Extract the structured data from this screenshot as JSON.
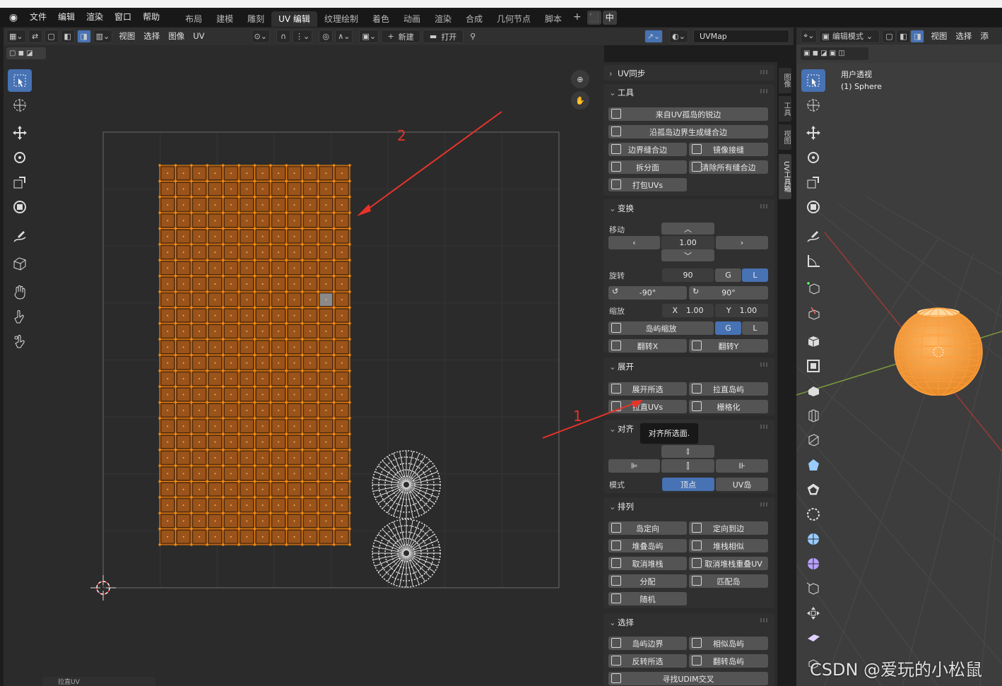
{
  "menubar": {
    "items": [
      "文件",
      "编辑",
      "渲染",
      "窗口",
      "帮助"
    ],
    "workspace_tabs": [
      "布局",
      "建模",
      "雕刻",
      "UV 编辑",
      "纹理绘制",
      "着色",
      "动画",
      "渲染",
      "合成",
      "几何节点",
      "脚本"
    ],
    "active_tab": "UV 编辑",
    "plus": "+",
    "lang_label": "中"
  },
  "uv_header": {
    "menus": [
      "视图",
      "选择",
      "图像",
      "UV"
    ],
    "new_label": "新建",
    "open_label": "打开",
    "uvmap_field": "UVMap",
    "plus_icon": "+"
  },
  "canvas": {
    "grid_dot_color": "#f28a14",
    "face_color": "#7a3f10",
    "edge_color": "#f28a14",
    "face_cols": 12,
    "face_rows": 24,
    "selected_gray_face": "#8a8a8a"
  },
  "annotations": {
    "arrow1_label": "1",
    "arrow2_label": "2",
    "arrow_color": "#e8332a"
  },
  "npanel": {
    "uv_sync": "UV同步",
    "tools": {
      "title": "工具",
      "btn_seams_from_islands": "来自UV孤岛的锐边",
      "btn_seams_from_islands_border": "沿孤岛边界生成缝合边",
      "btn_border_seams": "边界缝合边",
      "btn_mirror_seams": "镜像接缝",
      "btn_split_faces": "拆分面",
      "btn_clear_all_seams": "清除所有缝合边",
      "btn_pack_uvs": "打包UVs"
    },
    "transform": {
      "title": "变换",
      "move_label": "移动",
      "move_value": "1.00",
      "rotate_label": "旋转",
      "rotate_value": "90",
      "g_label": "G",
      "l_label": "L",
      "rot_minus": "-90°",
      "rot_plus": "90°",
      "scale_label": "缩放",
      "scale_x_label": "X",
      "scale_x_value": "1.00",
      "scale_y_label": "Y",
      "scale_y_value": "1.00",
      "island_scale": "岛屿缩放",
      "flip_x": "翻转X",
      "flip_y": "翻转Y"
    },
    "unwrap": {
      "title": "展开",
      "unwrap_selected": "展开所选",
      "straighten_islands": "拉直岛屿",
      "straighten_uvs": "拉直UVs",
      "gridify": "栅格化"
    },
    "align": {
      "title": "对齐",
      "mode_label": "模式",
      "mode_vertex": "顶点",
      "mode_uv_island": "UV岛"
    },
    "tooltip": "对齐所选面.",
    "arrange": {
      "title": "排列",
      "orient_island": "岛定向",
      "orient_to_edge": "定向到边",
      "stack_islands": "堆叠岛屿",
      "stack_similar": "堆栈相似",
      "unstack": "取消堆栈",
      "unstack_overlapped": "取消堆栈重叠UV",
      "distribute": "分配",
      "match_island": "匹配岛",
      "random": "随机"
    },
    "select": {
      "title": "选择",
      "island_border": "岛屿边界",
      "similar_island": "相似岛屿",
      "invert_select": "反转所选",
      "flip_island": "翻转岛屿",
      "find_udim": "寻找UDIM交叉"
    }
  },
  "vertical_tabs": [
    "图像",
    "工具",
    "视图",
    "UV工具箱"
  ],
  "viewport3d": {
    "mode": "编辑模式",
    "menus": [
      "视图",
      "选择",
      "添"
    ],
    "info_line1": "用户透视",
    "info_line2": "(1) Sphere",
    "sphere_color": "#f5a04a"
  },
  "statusbar": {
    "label": "拉直UV"
  },
  "watermark": "CSDN @爱玩的小松鼠"
}
